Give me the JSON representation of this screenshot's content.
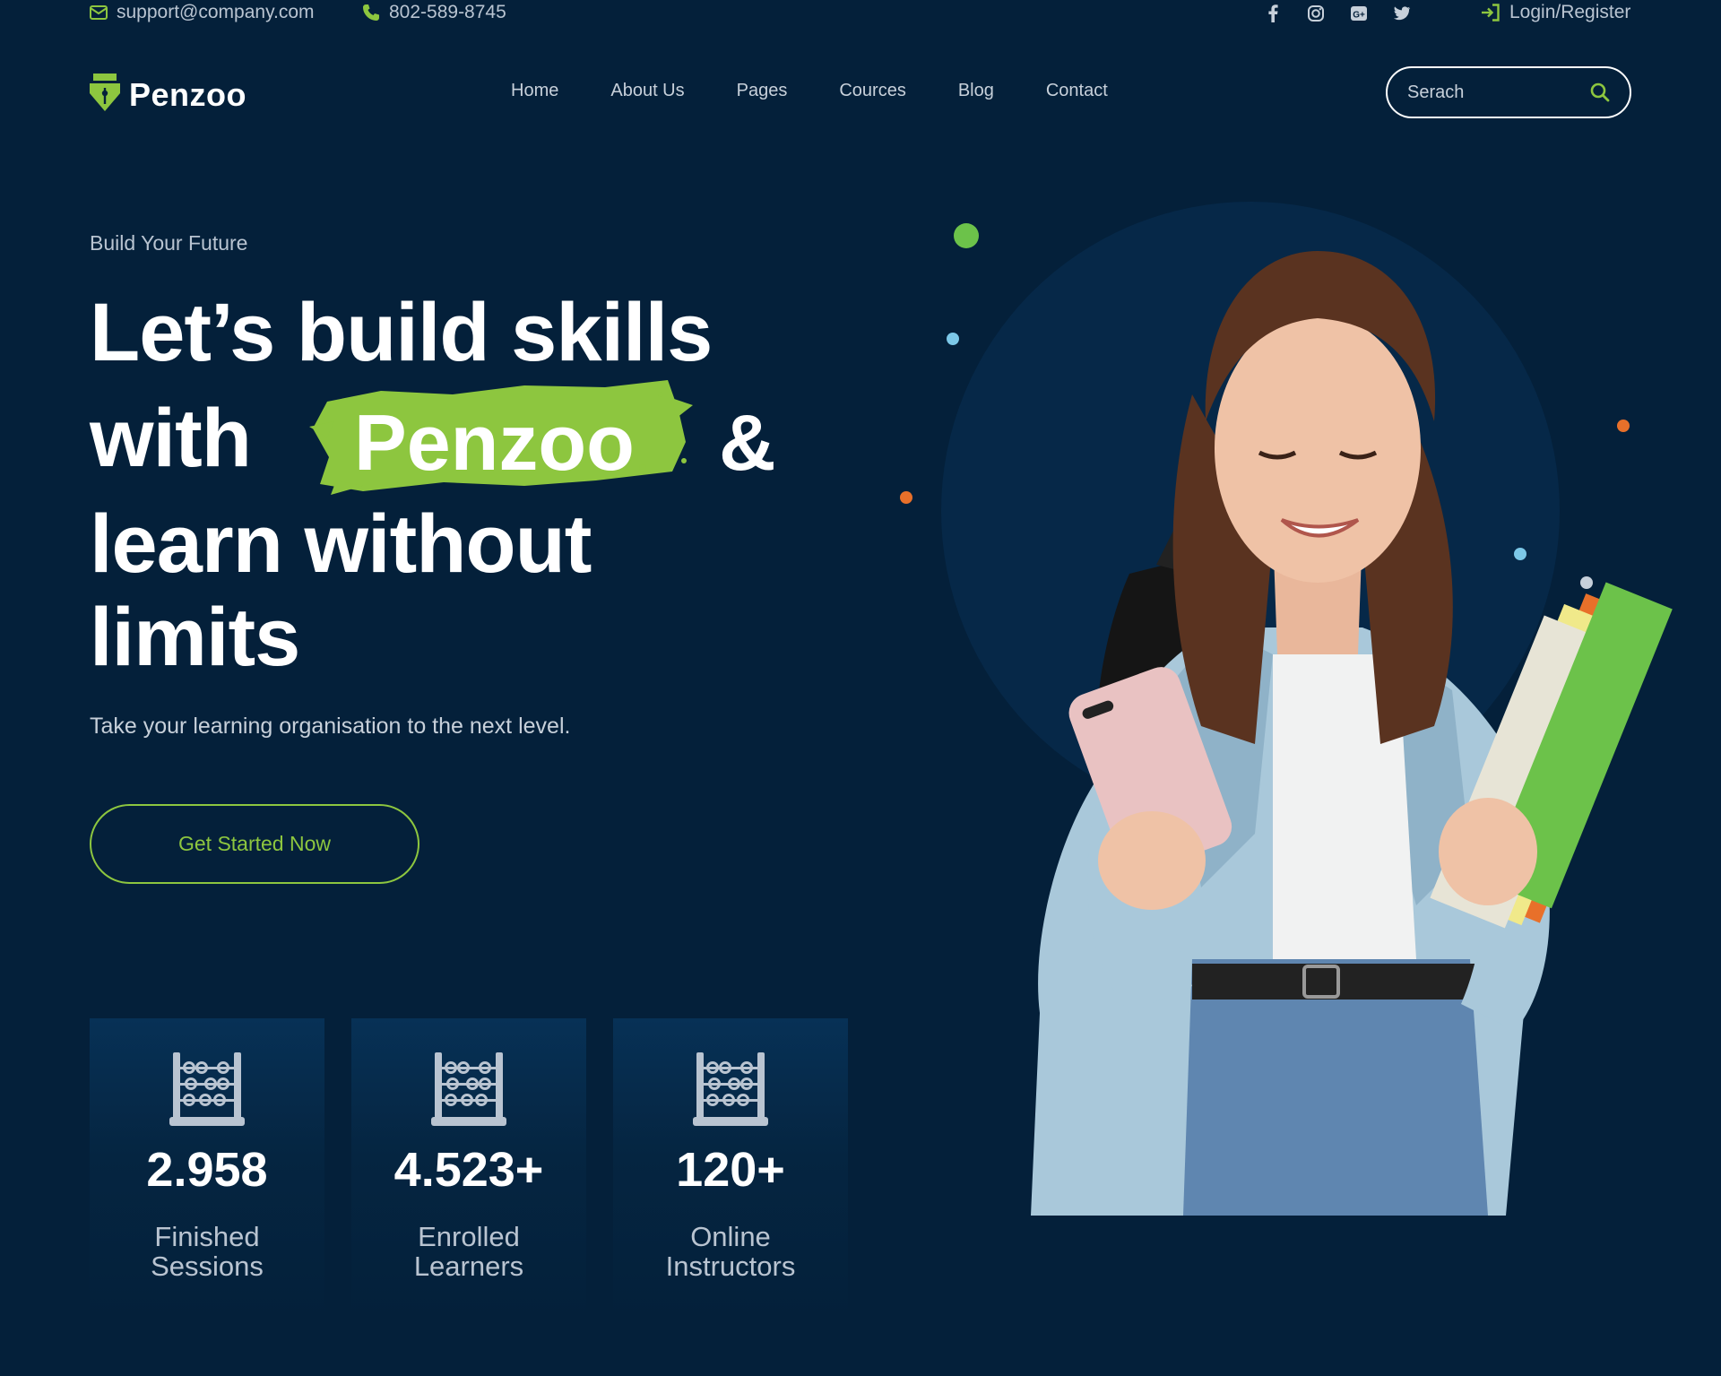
{
  "topbar": {
    "email": "support@company.com",
    "phone": "802-589-8745",
    "login": "Login/Register",
    "email_icon": "envelope-icon",
    "phone_icon": "phone-icon",
    "login_icon": "sign-in-icon",
    "social_icons": [
      "facebook-icon",
      "instagram-icon",
      "google-plus-icon",
      "twitter-icon"
    ]
  },
  "header": {
    "brand": "Penzoo",
    "nav": [
      "Home",
      "About Us",
      "Pages",
      "Cources",
      "Blog",
      "Contact"
    ],
    "search_placeholder": "Serach"
  },
  "hero": {
    "eyebrow": "Build Your Future",
    "headline_1": "Let’s build skills",
    "headline_2a": "with",
    "headline_highlight": "Penzoo",
    "headline_2b": "&",
    "headline_3": "learn without",
    "headline_4": "limits",
    "subtitle": "Take your learning organisation to the next level.",
    "cta": "Get Started Now"
  },
  "stats": [
    {
      "value": "2.958",
      "label_1": "Finished",
      "label_2": "Sessions",
      "icon": "abacus-icon"
    },
    {
      "value": "4.523+",
      "label_1": "Enrolled",
      "label_2": "Learners",
      "icon": "abacus-icon"
    },
    {
      "value": "120+",
      "label_1": "Online",
      "label_2": "Instructors",
      "icon": "abacus-icon"
    }
  ],
  "colors": {
    "background": "#04203a",
    "accent": "#8dc63f",
    "orange": "#e8702a",
    "light_blue": "#7cc8e8"
  }
}
